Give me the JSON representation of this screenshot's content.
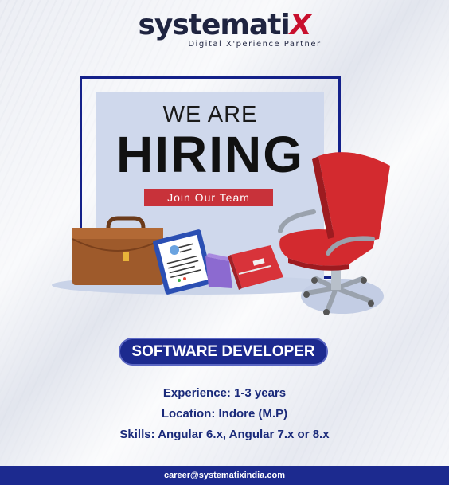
{
  "brand": {
    "name_prefix": "systemati",
    "name_suffix": "X",
    "tagline": "Digital X'perience Partner"
  },
  "hero": {
    "headline_small": "WE ARE",
    "headline_big": "HIRING",
    "cta_label": "Join Our Team"
  },
  "job": {
    "title": "SOFTWARE DEVELOPER",
    "experience": "Experience: 1-3 years",
    "location": "Location: Indore (M.P)",
    "skills": "Skills:  Angular 6.x, Angular 7.x or 8.x"
  },
  "footer": {
    "email": "career@systematixindia.com"
  },
  "colors": {
    "brand_navy": "#1c2a8f",
    "brand_red": "#c8102e",
    "cta_red": "#c8323a",
    "panel_blue": "#cfd8ec"
  },
  "icons": [
    "briefcase-icon",
    "resume-clipboard-icon",
    "book-icon",
    "binder-icon",
    "office-chair-icon"
  ]
}
